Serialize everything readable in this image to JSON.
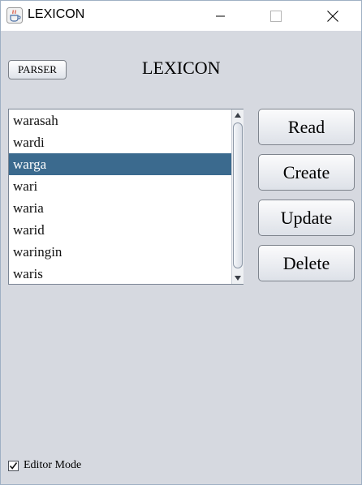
{
  "window": {
    "title": "LEXICON",
    "icon": "java-cup-icon"
  },
  "toolbar": {
    "parser_label": "PARSER",
    "heading": "LEXICON"
  },
  "word_list": {
    "items": [
      "warasah",
      "wardi",
      "warga",
      "wari",
      "waria",
      "warid",
      "waringin",
      "waris"
    ],
    "selected": "warga"
  },
  "actions": {
    "read": "Read",
    "create": "Create",
    "update": "Update",
    "delete": "Delete"
  },
  "editor_mode": {
    "label": "Editor Mode",
    "checked": true
  },
  "colors": {
    "selection": "#3b6a8e",
    "background": "#d6d9e0"
  }
}
